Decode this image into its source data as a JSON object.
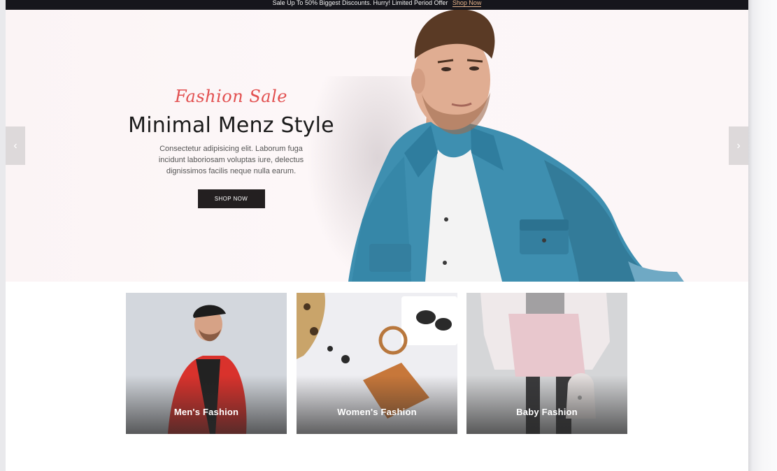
{
  "topbar": {
    "message": "Sale Up To 50% Biggest Discounts. Hurry! Limited Period Offer",
    "link_label": "Shop Now"
  },
  "hero": {
    "kicker": "Fashion Sale",
    "title": "Minimal Menz Style",
    "description": "Consectetur adipisicing elit. Laborum fuga incidunt laboriosam voluptas iure, delectus dignissimos facilis neque nulla earum.",
    "button_label": "SHOP NOW",
    "prev_icon": "chevron-left-icon",
    "next_icon": "chevron-right-icon"
  },
  "categories": [
    {
      "label": "Men's Fashion"
    },
    {
      "label": "Women's Fashion"
    },
    {
      "label": "Baby Fashion"
    }
  ],
  "colors": {
    "accent": "#e25050",
    "button": "#231f20",
    "topbar": "#16161c",
    "link": "#e7b48a"
  }
}
